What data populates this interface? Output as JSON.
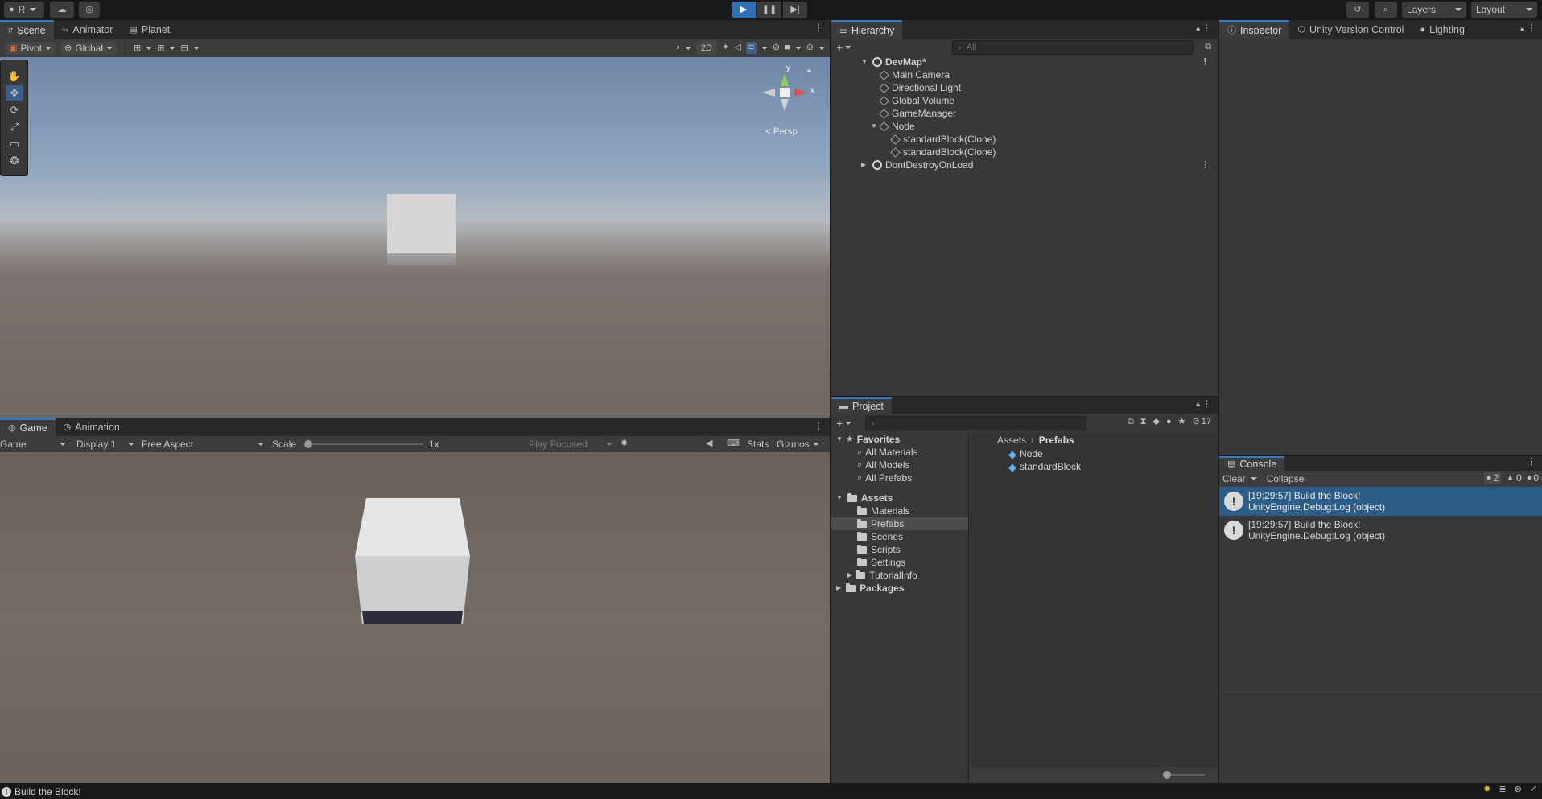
{
  "top_bar": {
    "account_label": "R",
    "layers_label": "Layers",
    "layout_label": "Layout"
  },
  "scene_panel": {
    "tabs": [
      {
        "label": "Scene",
        "icon": "grid-icon"
      },
      {
        "label": "Animator",
        "icon": "animator-icon"
      },
      {
        "label": "Planet",
        "icon": "planet-icon"
      }
    ],
    "pivot_label": "Pivot",
    "global_label": "Global",
    "twod_label": "2D",
    "gizmo_y": "y",
    "gizmo_x": "x",
    "persp_label": "< Persp"
  },
  "game_panel": {
    "tabs": [
      {
        "label": "Game",
        "icon": "gamepad-icon"
      },
      {
        "label": "Animation",
        "icon": "clock-icon"
      }
    ],
    "display_mode": "Game",
    "display": "Display 1",
    "aspect": "Free Aspect",
    "scale_label": "Scale",
    "scale_value": "1x",
    "scale_fraction": 0.0,
    "play_focused": "Play Focused",
    "stats_label": "Stats",
    "gizmos_label": "Gizmos"
  },
  "hierarchy": {
    "title": "Hierarchy",
    "search_placeholder": "All",
    "items": [
      {
        "label": "DevMap*",
        "type": "scene"
      },
      {
        "label": "Main Camera",
        "type": "object"
      },
      {
        "label": "Directional Light",
        "type": "object"
      },
      {
        "label": "Global Volume",
        "type": "object"
      },
      {
        "label": "GameManager",
        "type": "object"
      },
      {
        "label": "Node",
        "type": "object"
      },
      {
        "label": "standardBlock(Clone)",
        "type": "object"
      },
      {
        "label": "standardBlock(Clone)",
        "type": "object"
      },
      {
        "label": "DontDestroyOnLoad",
        "type": "scene"
      }
    ]
  },
  "inspector": {
    "tabs": [
      {
        "label": "Inspector",
        "icon": "info-icon"
      },
      {
        "label": "Unity Version Control",
        "icon": "version-control-icon"
      },
      {
        "label": "Lighting",
        "icon": "bulb-icon"
      }
    ]
  },
  "project": {
    "title": "Project",
    "hidden_count": "17",
    "favorites_label": "Favorites",
    "favorites": [
      "All Materials",
      "All Models",
      "All Prefabs"
    ],
    "assets_label": "Assets",
    "asset_folders": [
      "Materials",
      "Prefabs",
      "Scenes",
      "Scripts",
      "Settings",
      "TutorialInfo"
    ],
    "packages_label": "Packages",
    "breadcrumb": [
      "Assets",
      "Prefabs"
    ],
    "files": [
      "Node",
      "standardBlock"
    ]
  },
  "console": {
    "title": "Console",
    "clear_label": "Clear",
    "collapse_label": "Collapse",
    "log_count": "2",
    "warn_count": "0",
    "error_count": "0",
    "entries": [
      {
        "line1": "[19:29:57] Build the Block!",
        "line2": "UnityEngine.Debug:Log (object)"
      },
      {
        "line1": "[19:29:57] Build the Block!",
        "line2": "UnityEngine.Debug:Log (object)"
      }
    ]
  },
  "status_bar": {
    "message": "Build the Block!"
  },
  "colors": {
    "accent": "#3a79bb",
    "selected_row": "#2c5d87",
    "panel": "#383838",
    "toolbar": "#191919"
  }
}
